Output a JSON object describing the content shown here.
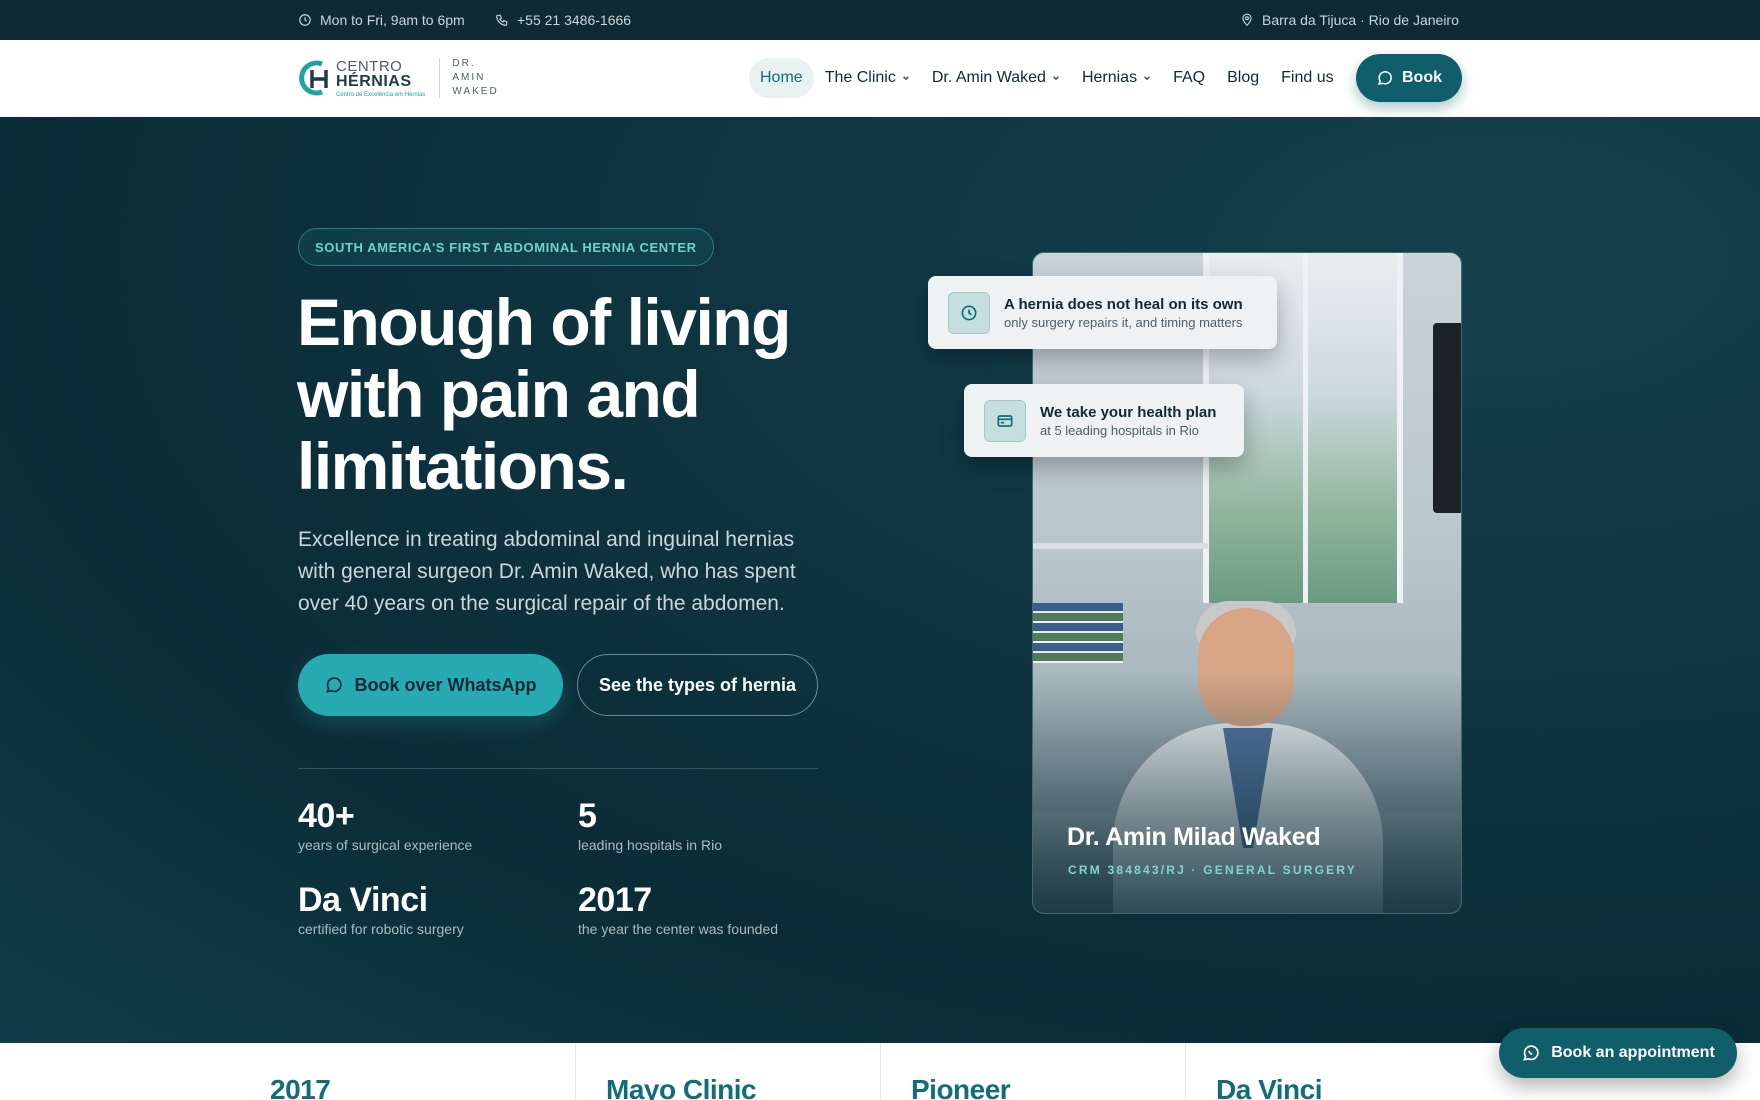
{
  "topbar": {
    "hours": "Mon to Fri, 9am to 6pm",
    "phone": "+55 21 3486-1666",
    "location": "Barra da Tijuca · Rio de Janeiro"
  },
  "logo": {
    "line1": "CENTRO",
    "line2": "HÉRNIAS",
    "tagline": "Centro de Excelência em Hérnias",
    "dr1": "DR.",
    "dr2": "AMIN",
    "dr3": "WAKED"
  },
  "nav": {
    "items": [
      {
        "label": "Home",
        "dropdown": false,
        "active": true
      },
      {
        "label": "The Clinic",
        "dropdown": true
      },
      {
        "label": "Dr. Amin Waked",
        "dropdown": true
      },
      {
        "label": "Hernias",
        "dropdown": true
      },
      {
        "label": "FAQ",
        "dropdown": false
      },
      {
        "label": "Blog",
        "dropdown": false
      },
      {
        "label": "Find us",
        "dropdown": false
      }
    ],
    "book_label": "Book"
  },
  "hero": {
    "eyebrow": "SOUTH AMERICA'S FIRST ABDOMINAL HERNIA CENTER",
    "headline": "Enough of living with pain and limitations.",
    "subtitle": "Excellence in treating abdominal and inguinal hernias with general surgeon Dr. Amin Waked, who has spent over 40 years on the surgical repair of the abdomen.",
    "cta_primary": "Book over WhatsApp",
    "cta_secondary": "See the types of hernia",
    "stats": [
      {
        "value": "40+",
        "label": "years of surgical experience"
      },
      {
        "value": "5",
        "label": "leading hospitals in Rio"
      },
      {
        "value": "Da Vinci",
        "label": "certified for robotic surgery"
      },
      {
        "value": "2017",
        "label": "the year the center was founded"
      }
    ]
  },
  "cards": [
    {
      "title": "A hernia does not heal on its own",
      "subtitle": "only surgery repairs it, and timing matters",
      "icon": "clock-icon"
    },
    {
      "title": "We take your health plan",
      "subtitle": "at 5 leading hospitals in Rio",
      "icon": "credit-card-icon"
    }
  ],
  "doctor": {
    "name": "Dr. Amin Milad Waked",
    "credential": "CRM 384843/RJ · GENERAL SURGERY"
  },
  "strip": [
    "2017",
    "Mayo Clinic",
    "Pioneer",
    "Da Vinci"
  ],
  "float_book": "Book an appointment",
  "colors": {
    "accent": "#27aab1",
    "brand_dark": "#0f5e6a",
    "hero_bg": "#0d2f3a"
  }
}
